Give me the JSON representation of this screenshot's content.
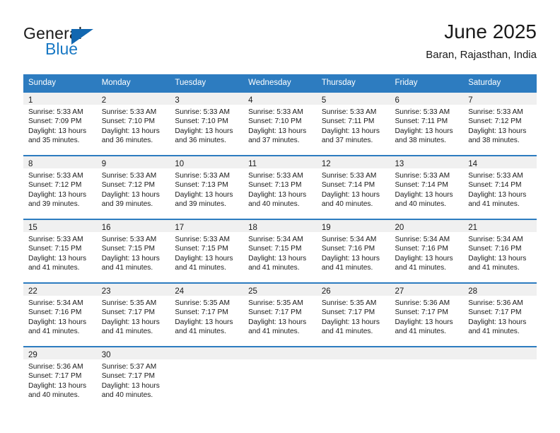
{
  "brand": {
    "name_part1": "General",
    "name_part2": "Blue",
    "triangle_color": "#1267b0",
    "blue_color": "#1878c4"
  },
  "header": {
    "title": "June 2025",
    "subtitle": "Baran, Rajasthan, India"
  },
  "theme": {
    "header_blue": "#2d7cc0",
    "daynum_band": "#f0f0f0",
    "text": "#1a1a1a"
  },
  "weekday_headers": [
    "Sunday",
    "Monday",
    "Tuesday",
    "Wednesday",
    "Thursday",
    "Friday",
    "Saturday"
  ],
  "weeks": [
    [
      {
        "day": "1",
        "sunrise": "Sunrise: 5:33 AM",
        "sunset": "Sunset: 7:09 PM",
        "daylight_1": "Daylight: 13 hours",
        "daylight_2": "and 35 minutes."
      },
      {
        "day": "2",
        "sunrise": "Sunrise: 5:33 AM",
        "sunset": "Sunset: 7:10 PM",
        "daylight_1": "Daylight: 13 hours",
        "daylight_2": "and 36 minutes."
      },
      {
        "day": "3",
        "sunrise": "Sunrise: 5:33 AM",
        "sunset": "Sunset: 7:10 PM",
        "daylight_1": "Daylight: 13 hours",
        "daylight_2": "and 36 minutes."
      },
      {
        "day": "4",
        "sunrise": "Sunrise: 5:33 AM",
        "sunset": "Sunset: 7:10 PM",
        "daylight_1": "Daylight: 13 hours",
        "daylight_2": "and 37 minutes."
      },
      {
        "day": "5",
        "sunrise": "Sunrise: 5:33 AM",
        "sunset": "Sunset: 7:11 PM",
        "daylight_1": "Daylight: 13 hours",
        "daylight_2": "and 37 minutes."
      },
      {
        "day": "6",
        "sunrise": "Sunrise: 5:33 AM",
        "sunset": "Sunset: 7:11 PM",
        "daylight_1": "Daylight: 13 hours",
        "daylight_2": "and 38 minutes."
      },
      {
        "day": "7",
        "sunrise": "Sunrise: 5:33 AM",
        "sunset": "Sunset: 7:12 PM",
        "daylight_1": "Daylight: 13 hours",
        "daylight_2": "and 38 minutes."
      }
    ],
    [
      {
        "day": "8",
        "sunrise": "Sunrise: 5:33 AM",
        "sunset": "Sunset: 7:12 PM",
        "daylight_1": "Daylight: 13 hours",
        "daylight_2": "and 39 minutes."
      },
      {
        "day": "9",
        "sunrise": "Sunrise: 5:33 AM",
        "sunset": "Sunset: 7:12 PM",
        "daylight_1": "Daylight: 13 hours",
        "daylight_2": "and 39 minutes."
      },
      {
        "day": "10",
        "sunrise": "Sunrise: 5:33 AM",
        "sunset": "Sunset: 7:13 PM",
        "daylight_1": "Daylight: 13 hours",
        "daylight_2": "and 39 minutes."
      },
      {
        "day": "11",
        "sunrise": "Sunrise: 5:33 AM",
        "sunset": "Sunset: 7:13 PM",
        "daylight_1": "Daylight: 13 hours",
        "daylight_2": "and 40 minutes."
      },
      {
        "day": "12",
        "sunrise": "Sunrise: 5:33 AM",
        "sunset": "Sunset: 7:14 PM",
        "daylight_1": "Daylight: 13 hours",
        "daylight_2": "and 40 minutes."
      },
      {
        "day": "13",
        "sunrise": "Sunrise: 5:33 AM",
        "sunset": "Sunset: 7:14 PM",
        "daylight_1": "Daylight: 13 hours",
        "daylight_2": "and 40 minutes."
      },
      {
        "day": "14",
        "sunrise": "Sunrise: 5:33 AM",
        "sunset": "Sunset: 7:14 PM",
        "daylight_1": "Daylight: 13 hours",
        "daylight_2": "and 41 minutes."
      }
    ],
    [
      {
        "day": "15",
        "sunrise": "Sunrise: 5:33 AM",
        "sunset": "Sunset: 7:15 PM",
        "daylight_1": "Daylight: 13 hours",
        "daylight_2": "and 41 minutes."
      },
      {
        "day": "16",
        "sunrise": "Sunrise: 5:33 AM",
        "sunset": "Sunset: 7:15 PM",
        "daylight_1": "Daylight: 13 hours",
        "daylight_2": "and 41 minutes."
      },
      {
        "day": "17",
        "sunrise": "Sunrise: 5:33 AM",
        "sunset": "Sunset: 7:15 PM",
        "daylight_1": "Daylight: 13 hours",
        "daylight_2": "and 41 minutes."
      },
      {
        "day": "18",
        "sunrise": "Sunrise: 5:34 AM",
        "sunset": "Sunset: 7:15 PM",
        "daylight_1": "Daylight: 13 hours",
        "daylight_2": "and 41 minutes."
      },
      {
        "day": "19",
        "sunrise": "Sunrise: 5:34 AM",
        "sunset": "Sunset: 7:16 PM",
        "daylight_1": "Daylight: 13 hours",
        "daylight_2": "and 41 minutes."
      },
      {
        "day": "20",
        "sunrise": "Sunrise: 5:34 AM",
        "sunset": "Sunset: 7:16 PM",
        "daylight_1": "Daylight: 13 hours",
        "daylight_2": "and 41 minutes."
      },
      {
        "day": "21",
        "sunrise": "Sunrise: 5:34 AM",
        "sunset": "Sunset: 7:16 PM",
        "daylight_1": "Daylight: 13 hours",
        "daylight_2": "and 41 minutes."
      }
    ],
    [
      {
        "day": "22",
        "sunrise": "Sunrise: 5:34 AM",
        "sunset": "Sunset: 7:16 PM",
        "daylight_1": "Daylight: 13 hours",
        "daylight_2": "and 41 minutes."
      },
      {
        "day": "23",
        "sunrise": "Sunrise: 5:35 AM",
        "sunset": "Sunset: 7:17 PM",
        "daylight_1": "Daylight: 13 hours",
        "daylight_2": "and 41 minutes."
      },
      {
        "day": "24",
        "sunrise": "Sunrise: 5:35 AM",
        "sunset": "Sunset: 7:17 PM",
        "daylight_1": "Daylight: 13 hours",
        "daylight_2": "and 41 minutes."
      },
      {
        "day": "25",
        "sunrise": "Sunrise: 5:35 AM",
        "sunset": "Sunset: 7:17 PM",
        "daylight_1": "Daylight: 13 hours",
        "daylight_2": "and 41 minutes."
      },
      {
        "day": "26",
        "sunrise": "Sunrise: 5:35 AM",
        "sunset": "Sunset: 7:17 PM",
        "daylight_1": "Daylight: 13 hours",
        "daylight_2": "and 41 minutes."
      },
      {
        "day": "27",
        "sunrise": "Sunrise: 5:36 AM",
        "sunset": "Sunset: 7:17 PM",
        "daylight_1": "Daylight: 13 hours",
        "daylight_2": "and 41 minutes."
      },
      {
        "day": "28",
        "sunrise": "Sunrise: 5:36 AM",
        "sunset": "Sunset: 7:17 PM",
        "daylight_1": "Daylight: 13 hours",
        "daylight_2": "and 41 minutes."
      }
    ],
    [
      {
        "day": "29",
        "sunrise": "Sunrise: 5:36 AM",
        "sunset": "Sunset: 7:17 PM",
        "daylight_1": "Daylight: 13 hours",
        "daylight_2": "and 40 minutes."
      },
      {
        "day": "30",
        "sunrise": "Sunrise: 5:37 AM",
        "sunset": "Sunset: 7:17 PM",
        "daylight_1": "Daylight: 13 hours",
        "daylight_2": "and 40 minutes."
      },
      {
        "day": "",
        "sunrise": "",
        "sunset": "",
        "daylight_1": "",
        "daylight_2": ""
      },
      {
        "day": "",
        "sunrise": "",
        "sunset": "",
        "daylight_1": "",
        "daylight_2": ""
      },
      {
        "day": "",
        "sunrise": "",
        "sunset": "",
        "daylight_1": "",
        "daylight_2": ""
      },
      {
        "day": "",
        "sunrise": "",
        "sunset": "",
        "daylight_1": "",
        "daylight_2": ""
      },
      {
        "day": "",
        "sunrise": "",
        "sunset": "",
        "daylight_1": "",
        "daylight_2": ""
      }
    ]
  ]
}
